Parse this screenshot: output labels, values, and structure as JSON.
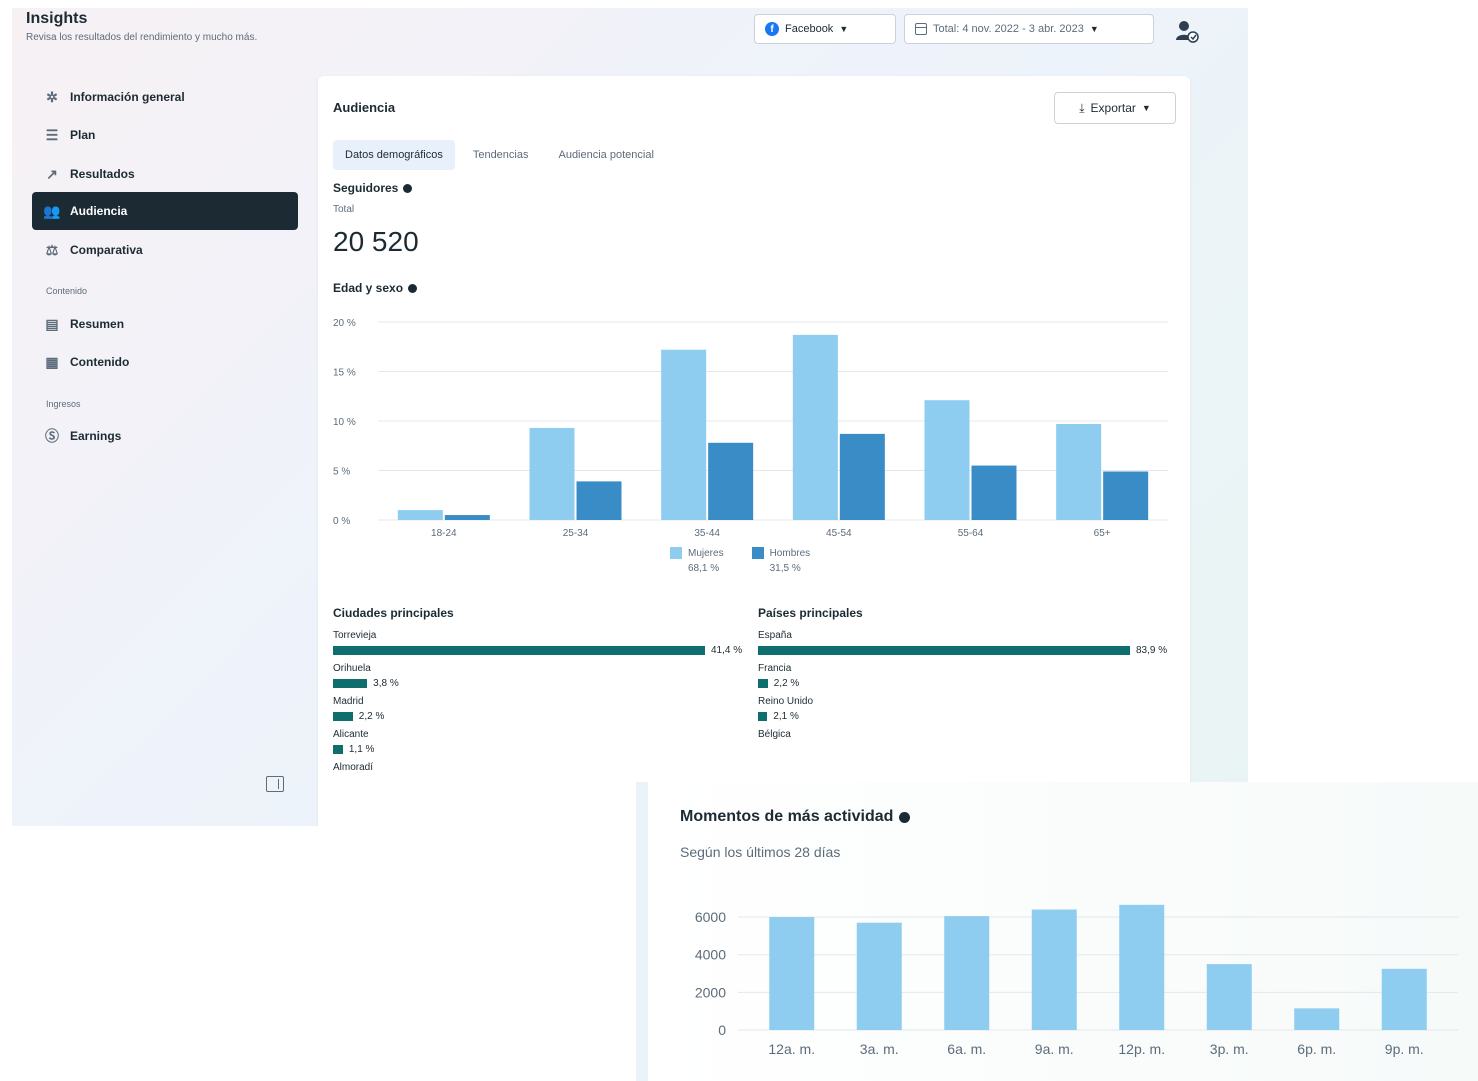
{
  "header": {
    "title": "Insights",
    "subtitle": "Revisa los resultados del rendimiento y mucho más.",
    "platform_label": "Facebook",
    "date_range_label": "Total: 4 nov. 2022 - 3 abr. 2023"
  },
  "sidebar": {
    "items": [
      {
        "label": "Información general",
        "icon": "sparkle-icon"
      },
      {
        "label": "Plan",
        "icon": "list-icon"
      },
      {
        "label": "Resultados",
        "icon": "trend-icon"
      },
      {
        "label": "Audiencia",
        "icon": "people-icon",
        "active": true
      },
      {
        "label": "Comparativa",
        "icon": "benchmark-icon"
      }
    ],
    "section_content": "Contenido",
    "content_items": [
      {
        "label": "Resumen",
        "icon": "summary-icon"
      },
      {
        "label": "Contenido",
        "icon": "grid-icon"
      }
    ],
    "section_income": "Ingresos",
    "income_items": [
      {
        "label": "Earnings",
        "icon": "dollar-icon"
      }
    ]
  },
  "audience": {
    "title": "Audiencia",
    "export_label": "Exportar",
    "tabs": [
      "Datos demográficos",
      "Tendencias",
      "Audiencia potencial"
    ],
    "followers_label": "Seguidores",
    "total_label": "Total",
    "total_value": "20 520",
    "age_gender_label": "Edad y sexo",
    "legend": [
      {
        "name": "Mujeres",
        "pct": "68,1 %",
        "color": "#8ecdf0"
      },
      {
        "name": "Hombres",
        "pct": "31,5 %",
        "color": "#3a8cc6"
      }
    ],
    "top_cities_label": "Ciudades principales",
    "top_countries_label": "Países principales",
    "cities": [
      {
        "name": "Torrevieja",
        "value": 41.4,
        "display": "41,4 %"
      },
      {
        "name": "Orihuela",
        "value": 3.8,
        "display": "3,8 %"
      },
      {
        "name": "Madrid",
        "value": 2.2,
        "display": "2,2 %"
      },
      {
        "name": "Alicante",
        "value": 1.1,
        "display": "1,1 %"
      },
      {
        "name": "Almoradí",
        "value": null,
        "display": ""
      }
    ],
    "countries": [
      {
        "name": "España",
        "value": 83.9,
        "display": "83,9 %"
      },
      {
        "name": "Francia",
        "value": 2.2,
        "display": "2,2 %"
      },
      {
        "name": "Reino Unido",
        "value": 2.1,
        "display": "2,1 %"
      },
      {
        "name": "Bélgica",
        "value": null,
        "display": ""
      }
    ]
  },
  "activity": {
    "title": "Momentos de más actividad",
    "subtitle": "Según los últimos 28 días"
  },
  "chart_data": [
    {
      "type": "bar",
      "categories": [
        "18-24",
        "25-34",
        "35-44",
        "45-54",
        "55-64",
        "65+"
      ],
      "series": [
        {
          "name": "Mujeres",
          "values": [
            1.0,
            9.3,
            17.2,
            18.7,
            12.1,
            9.7
          ],
          "color": "#8ecdf0"
        },
        {
          "name": "Hombres",
          "values": [
            0.5,
            3.9,
            7.8,
            8.7,
            5.5,
            4.9
          ],
          "color": "#3a8cc6"
        }
      ],
      "yticks": [
        "0 %",
        "5 %",
        "10 %",
        "15 %",
        "20 %"
      ],
      "ylim": [
        0,
        20
      ],
      "grid": true
    },
    {
      "type": "bar",
      "categories": [
        "12a. m.",
        "3a. m.",
        "6a. m.",
        "9a. m.",
        "12p. m.",
        "3p. m.",
        "6p. m.",
        "9p. m."
      ],
      "values": [
        6000,
        5700,
        6050,
        6400,
        6650,
        3500,
        1150,
        3250
      ],
      "color": "#8ecdf0",
      "yticks": [
        "0",
        "2000",
        "4000",
        "6000"
      ],
      "ylim": [
        0,
        6800
      ],
      "grid": true
    }
  ]
}
